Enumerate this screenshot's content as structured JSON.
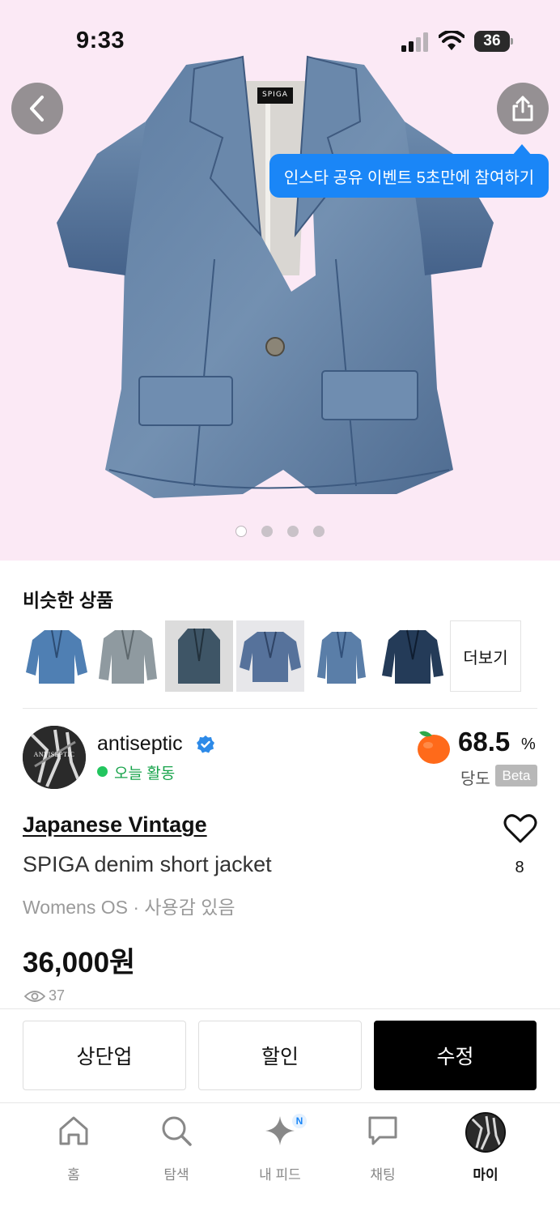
{
  "status_bar": {
    "time": "9:33",
    "battery": "36"
  },
  "colors": {
    "accent": "#1a86f7",
    "hero_bg": "#fbe9f5",
    "online_green": "#16a34a",
    "primary_button": "#000000"
  },
  "header": {
    "back_icon": "chevron-left-icon",
    "share_icon": "share-icon",
    "tooltip": "인스타 공유 이벤트 5초만에 참여하기"
  },
  "gallery": {
    "total": 4,
    "current": 1
  },
  "similar": {
    "title": "비슷한 상품",
    "more_label": "더보기",
    "items": [
      "denim-jacket-1",
      "denim-jacket-2",
      "denim-vest-3",
      "denim-jacket-4",
      "denim-jacket-5",
      "denim-jacket-6"
    ]
  },
  "seller": {
    "name": "antiseptic",
    "avatar_text": "ANTISEPTIC",
    "activity": "오늘 활동",
    "score": "68.5",
    "score_unit": "%",
    "score_label": "당도",
    "badge": "Beta"
  },
  "product": {
    "brand": "Japanese Vintage",
    "name": "SPIGA denim short jacket",
    "meta": "Womens OS · 사용감 있음",
    "price": "36,000원",
    "views": "37",
    "likes": "8",
    "tag": "SPIGA"
  },
  "actions": {
    "bump": "상단업",
    "discount": "할인",
    "edit": "수정"
  },
  "tabs": [
    {
      "label": "홈",
      "icon": "home-icon"
    },
    {
      "label": "탐색",
      "icon": "search-icon"
    },
    {
      "label": "내 피드",
      "icon": "sparkle-icon",
      "badge": "N"
    },
    {
      "label": "채팅",
      "icon": "chat-icon"
    },
    {
      "label": "마이",
      "icon": "profile-avatar"
    }
  ]
}
